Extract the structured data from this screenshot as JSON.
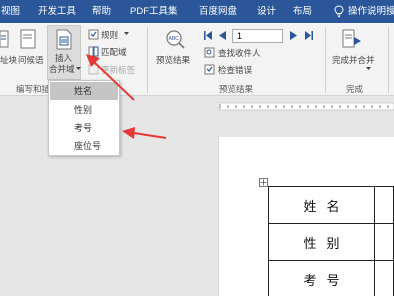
{
  "tabs": [
    "视图",
    "开发工具",
    "帮助",
    "PDF工具集",
    "百度网盘",
    "设计",
    "布局",
    "操作说明搜"
  ],
  "ribbon": {
    "partial_left_1": "址块",
    "partial_left_2": "问候语",
    "insert_field_line1": "插入",
    "insert_field_line2": "合并域",
    "rules_label": "规则",
    "match_fields_label": "匹配域",
    "update_labels_label": "更新标签",
    "preview_results_label": "预览结果",
    "record_number": "1",
    "find_recipient_label": "查找收件人",
    "check_errors_label": "检查错误",
    "finish_merge_label": "完成并合并",
    "group_write_insert": "编写和插",
    "group_preview": "预览结果",
    "group_finish": "完成"
  },
  "dropdown": {
    "items": [
      "姓名",
      "性别",
      "考号",
      "座位号"
    ],
    "highlighted_index": 0
  },
  "document": {
    "rows": [
      "姓名",
      "性别",
      "考号"
    ]
  },
  "colors": {
    "tab_bar": "#2b579a",
    "ribbon_bg": "#f3f3f3",
    "workspace": "#e6e6e6",
    "annotation_arrow": "#e53935"
  }
}
